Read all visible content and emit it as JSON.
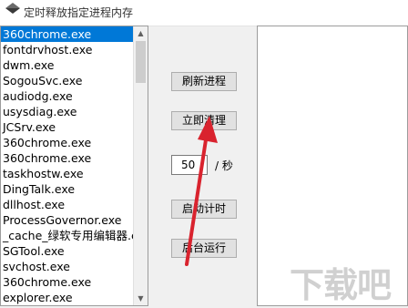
{
  "window": {
    "title": "定时释放指定进程内存",
    "icon": "app-icon"
  },
  "process_list": {
    "items": [
      "360chrome.exe",
      "fontdrvhost.exe",
      "dwm.exe",
      "SogouSvc.exe",
      "audiodg.exe",
      "usysdiag.exe",
      "JCSrv.exe",
      "360chrome.exe",
      "360chrome.exe",
      "taskhostw.exe",
      "DingTalk.exe",
      "dllhost.exe",
      "ProcessGovernor.exe",
      "_cache_绿软专用编辑器.ex",
      "SGTool.exe",
      "svchost.exe",
      "360chrome.exe",
      "explorer.exe"
    ],
    "selected_index": 0
  },
  "buttons": {
    "refresh": "刷新进程",
    "clean_now": "立即清理",
    "start_timer": "启动计时",
    "background": "后台运行"
  },
  "interval": {
    "value": "50",
    "unit": "/ 秒"
  },
  "watermark": "下载吧",
  "colors": {
    "selection": "#0078d7",
    "arrow": "#d9232e"
  }
}
